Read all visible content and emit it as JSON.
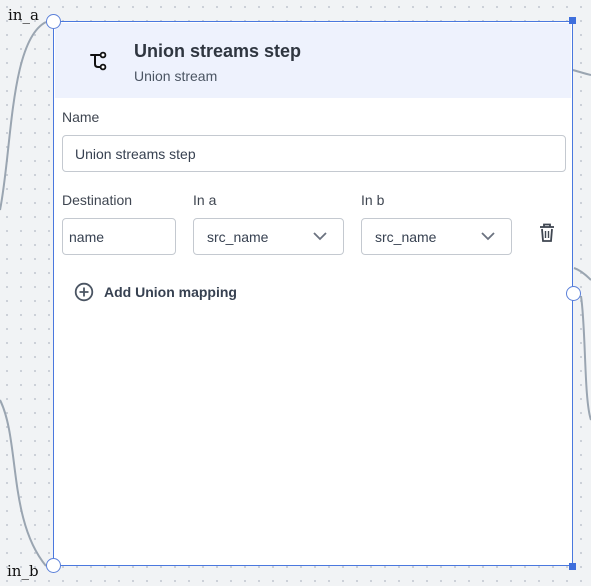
{
  "ports": {
    "in_a": "in_a",
    "in_b": "in_b"
  },
  "node": {
    "title": "Union streams step",
    "subtitle": "Union stream",
    "icon": "union-merge-icon"
  },
  "form": {
    "name_label": "Name",
    "name_value": "Union streams step",
    "destination_label": "Destination",
    "in_a_label": "In a",
    "in_b_label": "In b",
    "mapping": {
      "destination_value": "name",
      "in_a_value": "src_name",
      "in_b_value": "src_name"
    },
    "add_mapping_label": "Add Union mapping"
  },
  "colors": {
    "accent": "#4a78de",
    "header_bg": "#eef2fd",
    "edge": "#9aa5b1"
  }
}
